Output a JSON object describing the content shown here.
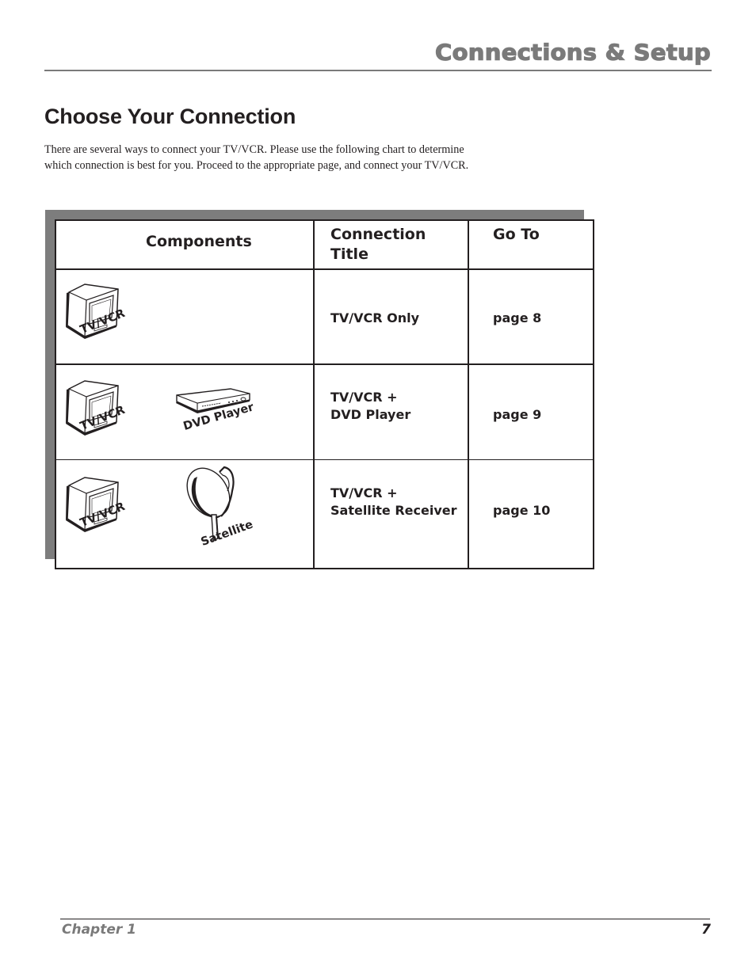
{
  "header": {
    "section_title": "Connections & Setup"
  },
  "page_title": "Choose Your Connection",
  "intro_lines": [
    "There are several ways to connect your TV/VCR. Please use the following chart to determine",
    "which connection is best for you. Proceed to the appropriate page, and connect your TV/VCR."
  ],
  "table": {
    "headers": {
      "components": "Components",
      "connection_title_line1": "Connection",
      "connection_title_line2": "Title",
      "go_to": "Go To"
    },
    "rows": [
      {
        "components": [
          {
            "icon": "tv-vcr-icon",
            "label": "TV/VCR"
          }
        ],
        "title_lines": [
          "TV/VCR Only"
        ],
        "go_to": "page 8"
      },
      {
        "components": [
          {
            "icon": "tv-vcr-icon",
            "label": "TV/VCR"
          },
          {
            "icon": "dvd-player-icon",
            "label": "DVD Player"
          }
        ],
        "title_lines": [
          "TV/VCR +",
          "DVD Player"
        ],
        "go_to": "page 9"
      },
      {
        "components": [
          {
            "icon": "tv-vcr-icon",
            "label": "TV/VCR"
          },
          {
            "icon": "satellite-dish-icon",
            "label": "Satellite"
          }
        ],
        "title_lines": [
          "TV/VCR +",
          "Satellite Receiver"
        ],
        "go_to": "page 10"
      }
    ]
  },
  "footer": {
    "chapter": "Chapter 1",
    "page_number": "7"
  }
}
